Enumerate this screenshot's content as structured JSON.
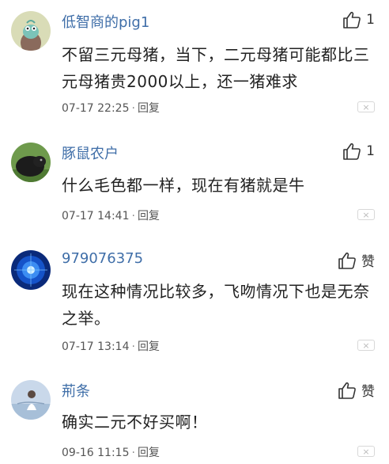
{
  "comments": [
    {
      "username": "低智商的pig1",
      "like_count": "1",
      "content": "不留三元母猪，当下，二元母猪可能都比三元母猪贵2000以上，还一猪难求",
      "timestamp": "07-17 22:25",
      "reply_label": "回复",
      "separator": "·",
      "close_glyph": "×",
      "avatar_icon": "cartoon-character"
    },
    {
      "username": "豚鼠农户",
      "like_count": "1",
      "content": "什么毛色都一样，现在有猪就是牛",
      "timestamp": "07-17 14:41",
      "reply_label": "回复",
      "separator": "·",
      "close_glyph": "×",
      "avatar_icon": "black-guinea-pig"
    },
    {
      "username": "979076375",
      "like_count": "赞",
      "content": "现在这种情况比较多，飞吻情况下也是无奈之举。",
      "timestamp": "07-17 13:14",
      "reply_label": "回复",
      "separator": "·",
      "close_glyph": "×",
      "avatar_icon": "blue-tech-orb"
    },
    {
      "username": "荊条",
      "like_count": "赞",
      "content": "确实二元不好买啊！",
      "timestamp": "09-16 11:15",
      "reply_label": "回复",
      "separator": "·",
      "close_glyph": "×",
      "avatar_icon": "person-landscape"
    }
  ],
  "colors": {
    "username": "#3f6ea8",
    "text": "#222222",
    "meta": "#555555"
  }
}
